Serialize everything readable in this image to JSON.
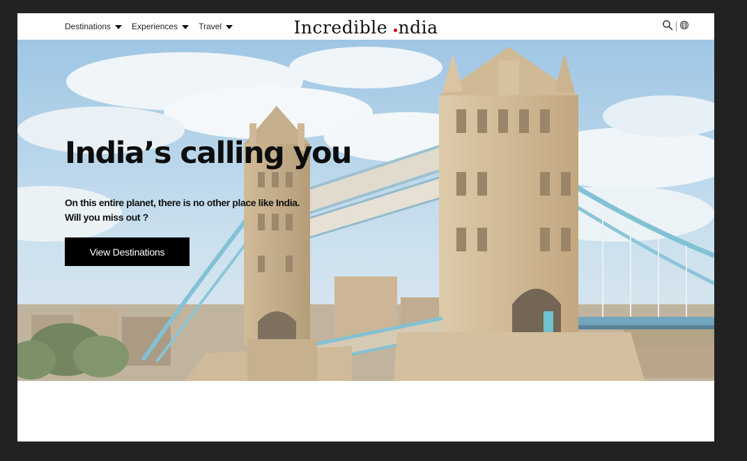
{
  "nav": {
    "items": [
      {
        "label": "Destinations",
        "icon": "chevron-down-icon"
      },
      {
        "label": "Experiences",
        "icon": "chevron-down-icon"
      },
      {
        "label": "Travel",
        "icon": "chevron-down-icon"
      }
    ],
    "logo": {
      "before": "Incredible ",
      "after": "ndia"
    },
    "tools": {
      "search_icon": "search-icon",
      "language_icon": "globe-icon"
    }
  },
  "hero": {
    "title": "India’s calling you",
    "subtitle_line1": "On this entire planet, there is no other place like India.",
    "subtitle_line2": "Will you miss out ?",
    "cta_label": "View Destinations",
    "image": "tower-bridge-photo"
  },
  "colors": {
    "page_bg": "#222222",
    "frame_bg": "#ffffff",
    "text": "#0d0d0d",
    "cta_bg": "#000000",
    "cta_text": "#ffffff",
    "logo_accent": "#d0021b",
    "sky": "#a9cce4",
    "stone": "#cdb58f",
    "steel": "#6fb7cf"
  }
}
